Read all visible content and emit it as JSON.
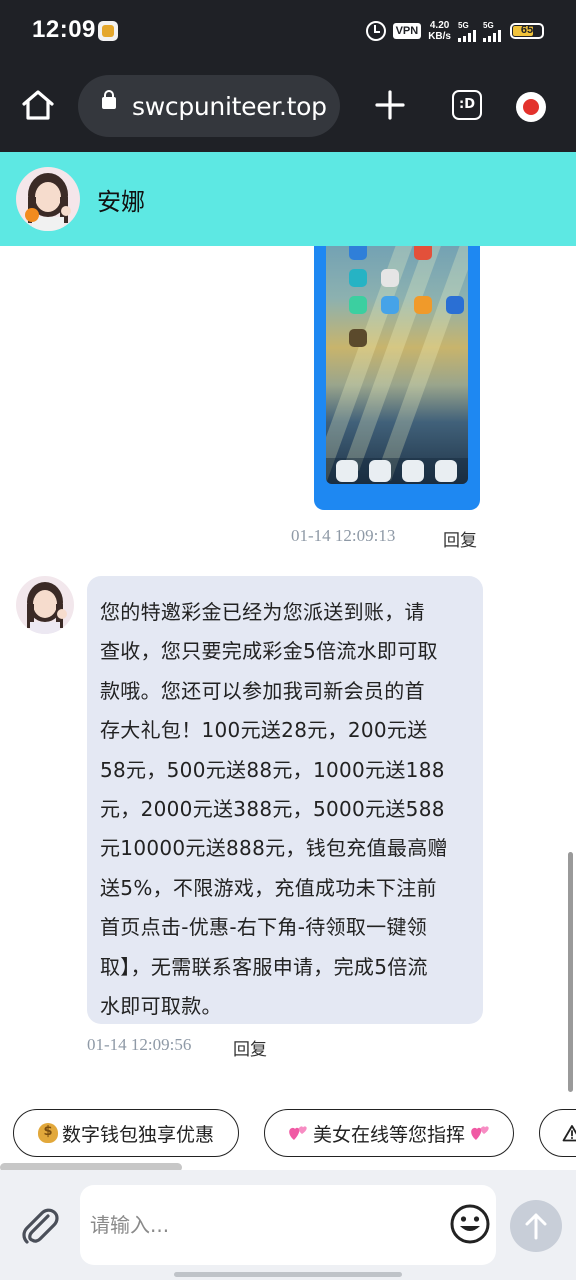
{
  "status_bar": {
    "time": "12:09",
    "vpn": "VPN",
    "speed_value": "4.20",
    "speed_unit": "KB/s",
    "signal1_label": "5G",
    "signal2_label": "5G",
    "battery": "65",
    "icons": [
      "app-notification-icon",
      "alarm-icon",
      "signal-icon",
      "battery-icon"
    ]
  },
  "browser": {
    "url": "swcpuniteer.top",
    "tabs_label": ":D",
    "icons": [
      "home-icon",
      "lock-icon",
      "plus-icon",
      "tabs-icon",
      "update-icon"
    ]
  },
  "chat_header": {
    "name": "安娜"
  },
  "messages": [
    {
      "type": "image",
      "side": "right",
      "timestamp": "01-14 12:09:13",
      "reply_label": "回复"
    },
    {
      "type": "text",
      "side": "left",
      "lines": [
        "您的特邀彩金已经为您派送到账，请",
        "查收，您只要完成彩金5倍流水即可取",
        "款哦。您还可以参加我司新会员的首",
        "存大礼包！100元送28元，200元送",
        "58元，500元送88元，1000元送188",
        "元，2000元送388元，5000元送588",
        "元10000元送888元，钱包充值最高赠",
        "送5%，不限游戏，充值成功未下注前",
        "首页点击-优惠-右下角-待领取一键领",
        "取】，无需联系客服申请，完成5倍流",
        "水即可取款。"
      ],
      "timestamp": "01-14 12:09:56",
      "reply_label": "回复"
    }
  ],
  "quick_chips": [
    {
      "label": "数字钱包独享优惠",
      "icon": "money-bag-icon"
    },
    {
      "label": "美女在线等您指挥",
      "icon": "two-hearts-icon"
    },
    {
      "label": "",
      "icon": "warning-icon"
    }
  ],
  "input": {
    "placeholder": "请输入..."
  },
  "colors": {
    "header_bg": "#5de8e3",
    "bubble_bg": "#e4e8f3",
    "dark_bar": "#1f2126",
    "image_frame": "#1e88f2"
  }
}
